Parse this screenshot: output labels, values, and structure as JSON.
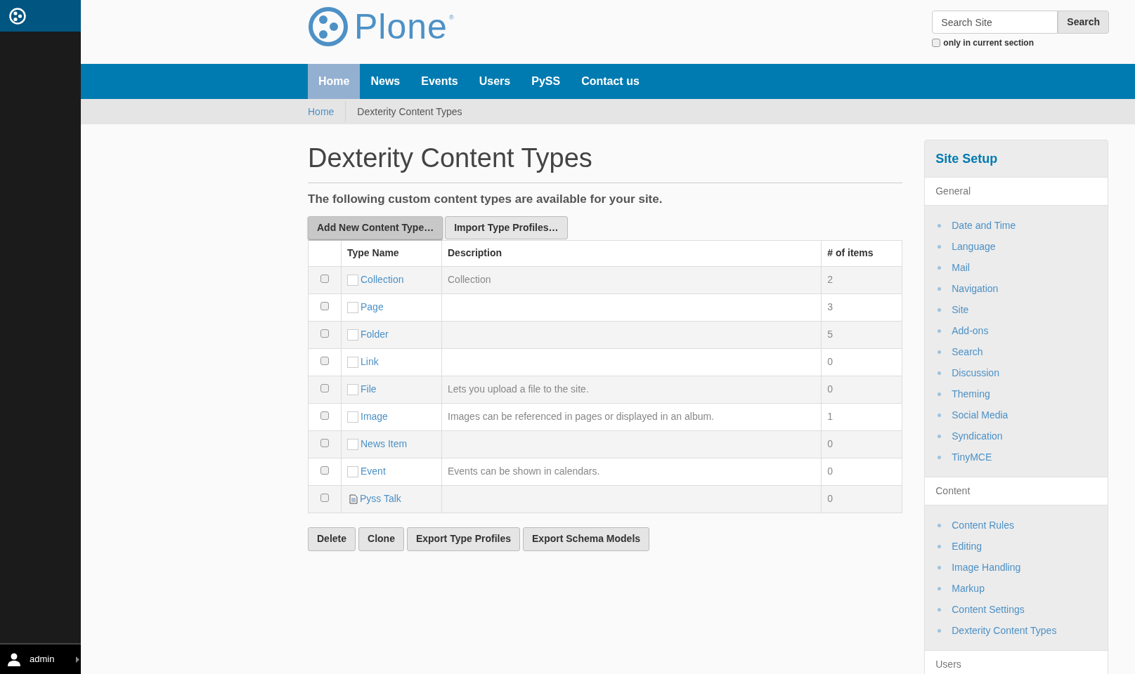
{
  "toolbar": {
    "user": "admin"
  },
  "header": {
    "brand": "Plone",
    "brand_mark": "®",
    "search": {
      "placeholder": "Search Site",
      "button": "Search",
      "only_current_label": "only in current section",
      "only_current_checked": false
    }
  },
  "nav": [
    {
      "label": "Home",
      "selected": true
    },
    {
      "label": "News",
      "selected": false
    },
    {
      "label": "Events",
      "selected": false
    },
    {
      "label": "Users",
      "selected": false
    },
    {
      "label": "PySS",
      "selected": false
    },
    {
      "label": "Contact us",
      "selected": false
    }
  ],
  "breadcrumb": [
    "Home",
    "Dexterity Content Types"
  ],
  "page": {
    "title": "Dexterity Content Types",
    "lead": "The following custom content types are available for your site.",
    "top_buttons": [
      {
        "label": "Add New Content Type…",
        "selected": true
      },
      {
        "label": "Import Type Profiles…",
        "selected": false
      }
    ]
  },
  "table": {
    "columns": [
      "Type Name",
      "Description",
      "# of items"
    ],
    "rows": [
      {
        "checked": false,
        "kind": "blank",
        "name": "Collection",
        "description": "Collection",
        "count": "2"
      },
      {
        "checked": false,
        "kind": "blank",
        "name": "Page",
        "description": "",
        "count": "3"
      },
      {
        "checked": false,
        "kind": "blank",
        "name": "Folder",
        "description": "",
        "count": "5"
      },
      {
        "checked": false,
        "kind": "blank",
        "name": "Link",
        "description": "",
        "count": "0"
      },
      {
        "checked": false,
        "kind": "blank",
        "name": "File",
        "description": "Lets you upload a file to the site.",
        "count": "0"
      },
      {
        "checked": false,
        "kind": "blank",
        "name": "Image",
        "description": "Images can be referenced in pages or displayed in an album.",
        "count": "1"
      },
      {
        "checked": false,
        "kind": "blank",
        "name": "News Item",
        "description": "",
        "count": "0"
      },
      {
        "checked": false,
        "kind": "blank",
        "name": "Event",
        "description": "Events can be shown in calendars.",
        "count": "0"
      },
      {
        "checked": false,
        "kind": "document",
        "name": "Pyss Talk",
        "description": "",
        "count": "0"
      }
    ]
  },
  "bottom_buttons": [
    "Delete",
    "Clone",
    "Export Type Profiles",
    "Export Schema Models"
  ],
  "portlet": {
    "title": "Site Setup",
    "sections": [
      {
        "heading": "General",
        "items": [
          "Date and Time",
          "Language",
          "Mail",
          "Navigation",
          "Site",
          "Add-ons",
          "Search",
          "Discussion",
          "Theming",
          "Social Media",
          "Syndication",
          "TinyMCE"
        ]
      },
      {
        "heading": "Content",
        "items": [
          "Content Rules",
          "Editing",
          "Image Handling",
          "Markup",
          "Content Settings",
          "Dexterity Content Types"
        ]
      },
      {
        "heading": "Users"
      }
    ]
  }
}
